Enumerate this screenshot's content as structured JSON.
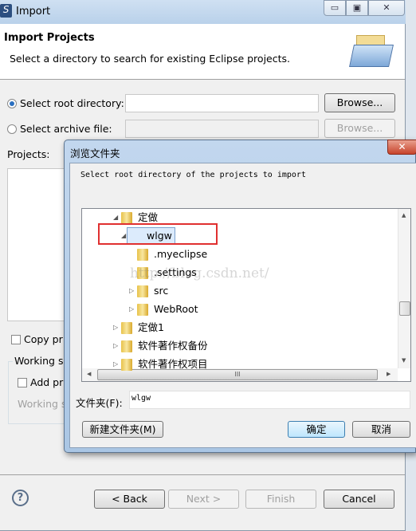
{
  "window": {
    "title": "Import",
    "minimize": "▭",
    "maximize": "▣",
    "close": "✕"
  },
  "header": {
    "title": "Import Projects",
    "subtitle": "Select a directory to search for existing Eclipse projects."
  },
  "form": {
    "root_label": "Select root directory:",
    "root_value": "",
    "root_selected": true,
    "archive_label": "Select archive file:",
    "archive_value": "",
    "browse": "Browse...",
    "browse2": "Browse...",
    "projects_label": "Projects:",
    "copy_label": "Copy pr",
    "working_sets_label": "Working s",
    "add_label": "Add pr",
    "working_sets_field": "Working s"
  },
  "footer": {
    "help": "?",
    "back": "< Back",
    "next": "Next >",
    "finish": "Finish",
    "cancel": "Cancel"
  },
  "browse_dialog": {
    "title": "浏览文件夹",
    "close": "✕",
    "instruction": "Select root directory of the projects to import",
    "tree": [
      {
        "label": "定做",
        "expanded": true,
        "level": 0
      },
      {
        "label": "wlgw",
        "expanded": true,
        "level": 1,
        "selected": true
      },
      {
        "label": ".myeclipse",
        "level": 2
      },
      {
        "label": ".settings",
        "level": 2
      },
      {
        "label": "src",
        "level": 2,
        "collapsed": true
      },
      {
        "label": "WebRoot",
        "level": 2,
        "collapsed": true
      },
      {
        "label": "定做1",
        "level": 0,
        "collapsed": true
      },
      {
        "label": "软件著作权备份",
        "level": 0,
        "collapsed": true
      },
      {
        "label": "软件著作权项目",
        "level": 0,
        "collapsed": true
      }
    ],
    "folder_label": "文件夹(F):",
    "folder_value": "wlgw",
    "new_folder": "新建文件夹(M)",
    "ok": "确定",
    "cancel": "取消",
    "highlight_color": "#e03030"
  },
  "watermark": "http://blog.csdn.net/"
}
